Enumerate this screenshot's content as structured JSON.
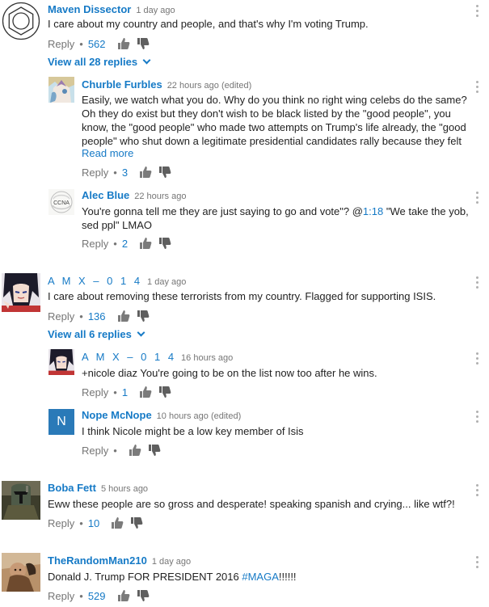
{
  "comments": [
    {
      "author": "Maven Dissector",
      "time": "1 day ago",
      "text": "I care about my country and people, and that's why I'm voting Trump.",
      "reply_label": "Reply",
      "likes": "562",
      "view_replies": "View all 28 replies",
      "replies": [
        {
          "author": "Churble Furbles",
          "time": "22 hours ago (edited)",
          "lines": [
            "Easily, we watch what you do.  Why do you think no right wing celebs do the same?",
            "Oh they do exist but they don't wish to be black listed by the \"good people\", you",
            "know, the \"good people\" who made two attempts on Trump's life already, the \"good",
            "people\" who shut down a legitimate presidential candidates rally because they felt"
          ],
          "read_more": "Read more",
          "reply_label": "Reply",
          "likes": "3"
        },
        {
          "author": "Alec Blue",
          "time": "22 hours ago",
          "text_before": "You're gonna tell me they are just saying to go and vote\"? @",
          "timestamp_link": "1:18",
          "text_after": " \"We take the yob,",
          "text_line2": "sed ppl\" LMAO",
          "avatar_text": "CCNA",
          "reply_label": "Reply",
          "likes": "2"
        }
      ]
    },
    {
      "author": "A M X – 0 1 4",
      "time": "1 day ago",
      "text": "I care about removing these terrorists from my country. Flagged for supporting ISIS.",
      "reply_label": "Reply",
      "likes": "136",
      "view_replies": "View all 6 replies",
      "replies": [
        {
          "author": "A M X – 0 1 4",
          "time": "16 hours ago",
          "text": "+nicole diaz You're going to be on the list now too after he wins.",
          "reply_label": "Reply",
          "likes": "1"
        },
        {
          "author": "Nope McNope",
          "time": "10 hours ago (edited)",
          "text": "I think Nicole might be a low key member of Isis",
          "avatar_letter": "N",
          "reply_label": "Reply",
          "likes": ""
        }
      ]
    },
    {
      "author": "Boba Fett",
      "time": "5 hours ago",
      "text": "Eww these people are so gross and desperate! speaking spanish and crying... like wtf?!",
      "reply_label": "Reply",
      "likes": "10"
    },
    {
      "author": "TheRandomMan210",
      "time": "1 day ago",
      "text_before": "Donald J. Trump FOR PRESIDENT 2016 ",
      "hashtag": "#MAGA",
      "text_after": "!!!!!!",
      "reply_label": "Reply",
      "likes": "529"
    }
  ],
  "colors": {
    "link": "#167ac6",
    "meta": "#767676",
    "text": "#222222",
    "avatar_n": "#2a7ab8"
  }
}
